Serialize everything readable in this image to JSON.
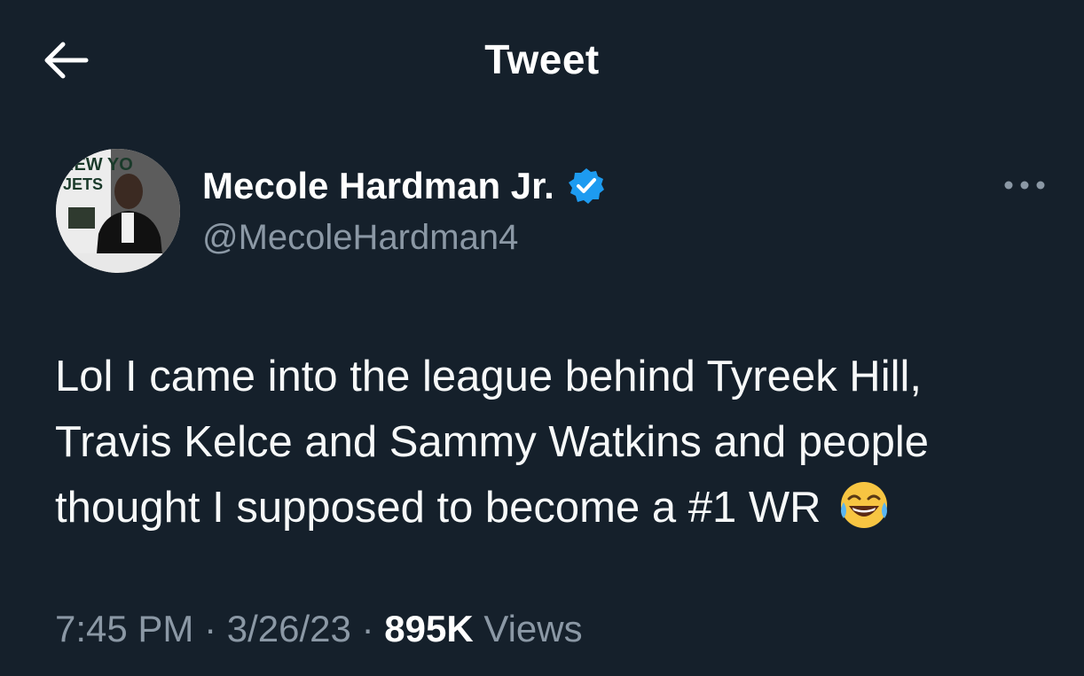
{
  "header": {
    "title": "Tweet",
    "back_icon": "back-arrow-icon"
  },
  "author": {
    "display_name": "Mecole Hardman Jr.",
    "handle": "@MecoleHardman4",
    "verified": true,
    "verified_color": "#1d9bf0",
    "avatar_text": [
      "NEW YO",
      "JETS"
    ]
  },
  "tweet": {
    "text": "Lol I came into the league behind Tyreek Hill, Travis Kelce and Sammy Watkins and people thought I supposed to become a #1 WR",
    "emoji": "face-with-tears-of-joy"
  },
  "meta": {
    "time": "7:45 PM",
    "separator": "·",
    "date": "3/26/23",
    "views_count": "895K",
    "views_label": "Views"
  },
  "colors": {
    "background": "#15202b",
    "text_primary": "#ffffff",
    "text_secondary": "#8b98a5"
  }
}
